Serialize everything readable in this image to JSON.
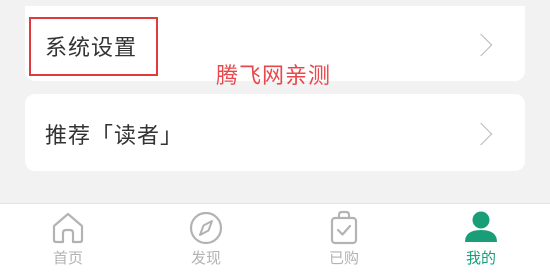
{
  "menu": {
    "settings_label": "系统设置",
    "recommend_label": "推荐「读者」"
  },
  "watermark": "腾飞网亲测",
  "tabbar": {
    "items": [
      {
        "label": "首页",
        "icon": "home-icon",
        "active": false
      },
      {
        "label": "发现",
        "icon": "compass-icon",
        "active": false
      },
      {
        "label": "已购",
        "icon": "shopping-bag-icon",
        "active": false
      },
      {
        "label": "我的",
        "icon": "user-icon",
        "active": true
      }
    ]
  },
  "colors": {
    "accent": "#1a9e78",
    "inactive": "#b3b3b3",
    "highlight": "#e0393e",
    "background": "#f2f2f2"
  }
}
